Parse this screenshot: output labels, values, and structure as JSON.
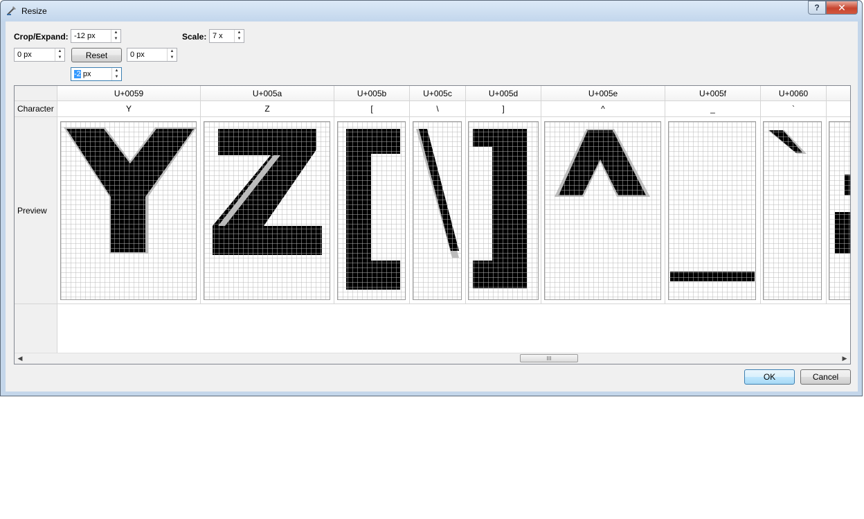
{
  "window": {
    "title": "Resize",
    "help_label": "?",
    "close_label": "✕"
  },
  "controls": {
    "crop_label": "Crop/Expand:",
    "top_value": "-12 px",
    "left_value": "0 px",
    "reset_label": "Reset",
    "right_value": "0 px",
    "bottom_value_selected": "-2",
    "bottom_value_rest": " px",
    "scale_label": "Scale:",
    "scale_value": "7 x"
  },
  "table": {
    "row_headers": {
      "character": "Character",
      "preview": "Preview"
    },
    "columns": [
      {
        "code": "U+0059",
        "char": "Y"
      },
      {
        "code": "U+005a",
        "char": "Z"
      },
      {
        "code": "U+005b",
        "char": "["
      },
      {
        "code": "U+005c",
        "char": "\\"
      },
      {
        "code": "U+005d",
        "char": "]"
      },
      {
        "code": "U+005e",
        "char": "^"
      },
      {
        "code": "U+005f",
        "char": "_"
      },
      {
        "code": "U+0060",
        "char": "`"
      }
    ],
    "scroll_thumb_grip": "III"
  },
  "buttons": {
    "ok_label": "OK",
    "cancel_label": "Cancel"
  }
}
